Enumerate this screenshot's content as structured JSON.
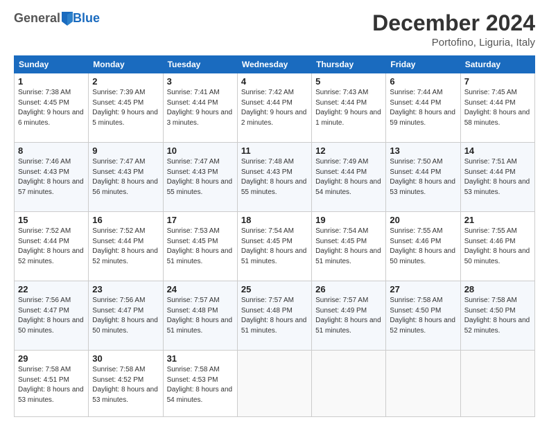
{
  "header": {
    "logo_general": "General",
    "logo_blue": "Blue",
    "month_title": "December 2024",
    "location": "Portofino, Liguria, Italy"
  },
  "days_of_week": [
    "Sunday",
    "Monday",
    "Tuesday",
    "Wednesday",
    "Thursday",
    "Friday",
    "Saturday"
  ],
  "weeks": [
    [
      {
        "day": "1",
        "sunrise": "Sunrise: 7:38 AM",
        "sunset": "Sunset: 4:45 PM",
        "daylight": "Daylight: 9 hours and 6 minutes."
      },
      {
        "day": "2",
        "sunrise": "Sunrise: 7:39 AM",
        "sunset": "Sunset: 4:45 PM",
        "daylight": "Daylight: 9 hours and 5 minutes."
      },
      {
        "day": "3",
        "sunrise": "Sunrise: 7:41 AM",
        "sunset": "Sunset: 4:44 PM",
        "daylight": "Daylight: 9 hours and 3 minutes."
      },
      {
        "day": "4",
        "sunrise": "Sunrise: 7:42 AM",
        "sunset": "Sunset: 4:44 PM",
        "daylight": "Daylight: 9 hours and 2 minutes."
      },
      {
        "day": "5",
        "sunrise": "Sunrise: 7:43 AM",
        "sunset": "Sunset: 4:44 PM",
        "daylight": "Daylight: 9 hours and 1 minute."
      },
      {
        "day": "6",
        "sunrise": "Sunrise: 7:44 AM",
        "sunset": "Sunset: 4:44 PM",
        "daylight": "Daylight: 8 hours and 59 minutes."
      },
      {
        "day": "7",
        "sunrise": "Sunrise: 7:45 AM",
        "sunset": "Sunset: 4:44 PM",
        "daylight": "Daylight: 8 hours and 58 minutes."
      }
    ],
    [
      {
        "day": "8",
        "sunrise": "Sunrise: 7:46 AM",
        "sunset": "Sunset: 4:43 PM",
        "daylight": "Daylight: 8 hours and 57 minutes."
      },
      {
        "day": "9",
        "sunrise": "Sunrise: 7:47 AM",
        "sunset": "Sunset: 4:43 PM",
        "daylight": "Daylight: 8 hours and 56 minutes."
      },
      {
        "day": "10",
        "sunrise": "Sunrise: 7:47 AM",
        "sunset": "Sunset: 4:43 PM",
        "daylight": "Daylight: 8 hours and 55 minutes."
      },
      {
        "day": "11",
        "sunrise": "Sunrise: 7:48 AM",
        "sunset": "Sunset: 4:43 PM",
        "daylight": "Daylight: 8 hours and 55 minutes."
      },
      {
        "day": "12",
        "sunrise": "Sunrise: 7:49 AM",
        "sunset": "Sunset: 4:44 PM",
        "daylight": "Daylight: 8 hours and 54 minutes."
      },
      {
        "day": "13",
        "sunrise": "Sunrise: 7:50 AM",
        "sunset": "Sunset: 4:44 PM",
        "daylight": "Daylight: 8 hours and 53 minutes."
      },
      {
        "day": "14",
        "sunrise": "Sunrise: 7:51 AM",
        "sunset": "Sunset: 4:44 PM",
        "daylight": "Daylight: 8 hours and 53 minutes."
      }
    ],
    [
      {
        "day": "15",
        "sunrise": "Sunrise: 7:52 AM",
        "sunset": "Sunset: 4:44 PM",
        "daylight": "Daylight: 8 hours and 52 minutes."
      },
      {
        "day": "16",
        "sunrise": "Sunrise: 7:52 AM",
        "sunset": "Sunset: 4:44 PM",
        "daylight": "Daylight: 8 hours and 52 minutes."
      },
      {
        "day": "17",
        "sunrise": "Sunrise: 7:53 AM",
        "sunset": "Sunset: 4:45 PM",
        "daylight": "Daylight: 8 hours and 51 minutes."
      },
      {
        "day": "18",
        "sunrise": "Sunrise: 7:54 AM",
        "sunset": "Sunset: 4:45 PM",
        "daylight": "Daylight: 8 hours and 51 minutes."
      },
      {
        "day": "19",
        "sunrise": "Sunrise: 7:54 AM",
        "sunset": "Sunset: 4:45 PM",
        "daylight": "Daylight: 8 hours and 51 minutes."
      },
      {
        "day": "20",
        "sunrise": "Sunrise: 7:55 AM",
        "sunset": "Sunset: 4:46 PM",
        "daylight": "Daylight: 8 hours and 50 minutes."
      },
      {
        "day": "21",
        "sunrise": "Sunrise: 7:55 AM",
        "sunset": "Sunset: 4:46 PM",
        "daylight": "Daylight: 8 hours and 50 minutes."
      }
    ],
    [
      {
        "day": "22",
        "sunrise": "Sunrise: 7:56 AM",
        "sunset": "Sunset: 4:47 PM",
        "daylight": "Daylight: 8 hours and 50 minutes."
      },
      {
        "day": "23",
        "sunrise": "Sunrise: 7:56 AM",
        "sunset": "Sunset: 4:47 PM",
        "daylight": "Daylight: 8 hours and 50 minutes."
      },
      {
        "day": "24",
        "sunrise": "Sunrise: 7:57 AM",
        "sunset": "Sunset: 4:48 PM",
        "daylight": "Daylight: 8 hours and 51 minutes."
      },
      {
        "day": "25",
        "sunrise": "Sunrise: 7:57 AM",
        "sunset": "Sunset: 4:48 PM",
        "daylight": "Daylight: 8 hours and 51 minutes."
      },
      {
        "day": "26",
        "sunrise": "Sunrise: 7:57 AM",
        "sunset": "Sunset: 4:49 PM",
        "daylight": "Daylight: 8 hours and 51 minutes."
      },
      {
        "day": "27",
        "sunrise": "Sunrise: 7:58 AM",
        "sunset": "Sunset: 4:50 PM",
        "daylight": "Daylight: 8 hours and 52 minutes."
      },
      {
        "day": "28",
        "sunrise": "Sunrise: 7:58 AM",
        "sunset": "Sunset: 4:50 PM",
        "daylight": "Daylight: 8 hours and 52 minutes."
      }
    ],
    [
      {
        "day": "29",
        "sunrise": "Sunrise: 7:58 AM",
        "sunset": "Sunset: 4:51 PM",
        "daylight": "Daylight: 8 hours and 53 minutes."
      },
      {
        "day": "30",
        "sunrise": "Sunrise: 7:58 AM",
        "sunset": "Sunset: 4:52 PM",
        "daylight": "Daylight: 8 hours and 53 minutes."
      },
      {
        "day": "31",
        "sunrise": "Sunrise: 7:58 AM",
        "sunset": "Sunset: 4:53 PM",
        "daylight": "Daylight: 8 hours and 54 minutes."
      },
      null,
      null,
      null,
      null
    ]
  ]
}
